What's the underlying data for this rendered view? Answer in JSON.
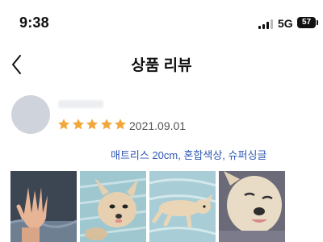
{
  "status_bar": {
    "time": "9:38",
    "network": "5G",
    "battery": "57"
  },
  "header": {
    "title": "상품 리뷰",
    "back_icon": "chevron-left-icon"
  },
  "review": {
    "rating": 5,
    "max_rating": 5,
    "star_color": "#f2a73b",
    "date": "2021.09.01",
    "option": "매트리스 20cm, 혼합색상, 슈퍼싱글",
    "option_color": "#2f57b2",
    "photos": [
      {
        "subject": "hand-on-mattress"
      },
      {
        "subject": "dog-lying-on-blanket"
      },
      {
        "subject": "dog-stretched-on-mattress"
      },
      {
        "subject": "dog-face-closeup"
      }
    ]
  }
}
